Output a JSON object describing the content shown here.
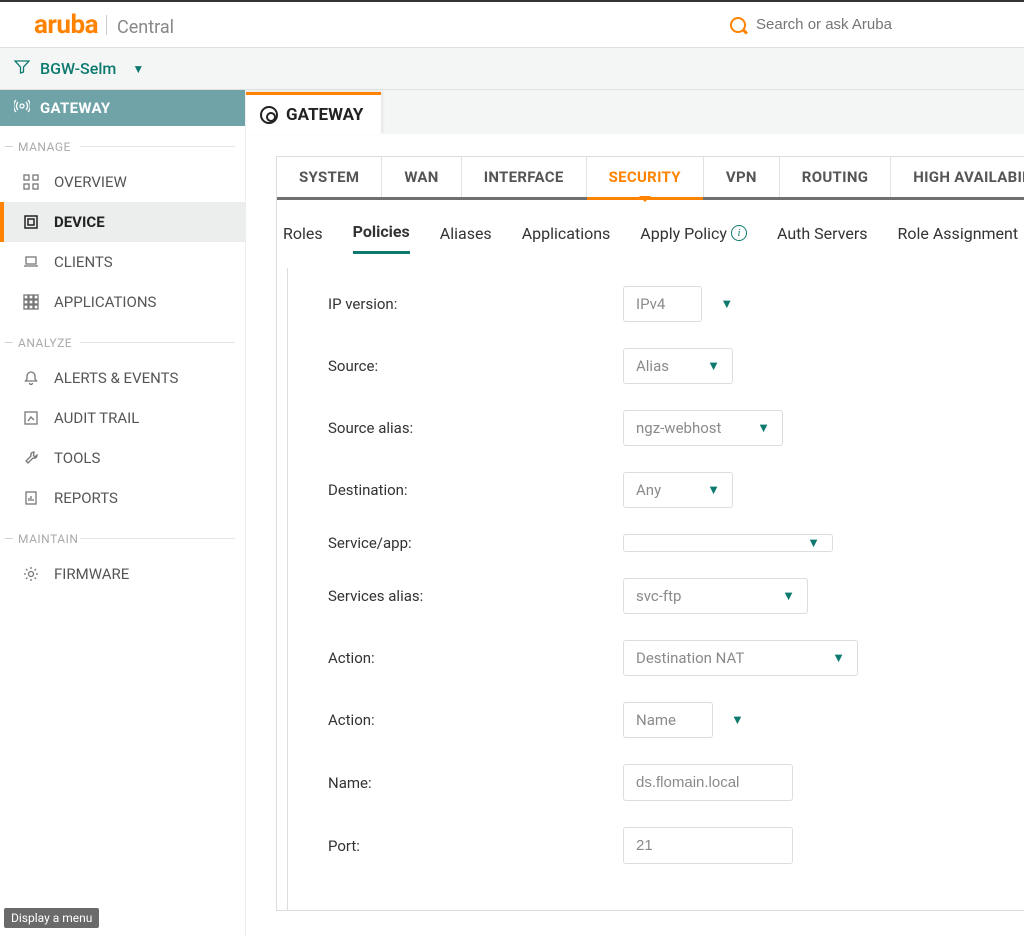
{
  "brand": {
    "name": "aruba",
    "product": "Central"
  },
  "search": {
    "placeholder": "Search or ask Aruba"
  },
  "breadcrumb": {
    "name": "BGW-Selm"
  },
  "sidebar": {
    "header": "GATEWAY",
    "groups": {
      "manage": "MANAGE",
      "analyze": "ANALYZE",
      "maintain": "MAINTAIN"
    },
    "items": {
      "overview": "OVERVIEW",
      "device": "DEVICE",
      "clients": "CLIENTS",
      "applications": "APPLICATIONS",
      "alerts": "ALERTS & EVENTS",
      "audit": "AUDIT TRAIL",
      "tools": "TOOLS",
      "reports": "REPORTS",
      "firmware": "FIRMWARE"
    }
  },
  "mainTab": "GATEWAY",
  "confTabs": {
    "system": "SYSTEM",
    "wan": "WAN",
    "interface": "INTERFACE",
    "security": "SECURITY",
    "vpn": "VPN",
    "routing": "ROUTING",
    "ha": "HIGH AVAILABILITY"
  },
  "subTabs": {
    "roles": "Roles",
    "policies": "Policies",
    "aliases": "Aliases",
    "applications": "Applications",
    "applyPolicy": "Apply Policy",
    "authServers": "Auth Servers",
    "roleAssign": "Role Assignment"
  },
  "form": {
    "ipVersion": {
      "label": "IP version:",
      "value": "IPv4"
    },
    "source": {
      "label": "Source:",
      "value": "Alias"
    },
    "sourceAlias": {
      "label": "Source alias:",
      "value": "ngz-webhost"
    },
    "destination": {
      "label": "Destination:",
      "value": "Any"
    },
    "serviceApp": {
      "label": "Service/app:",
      "value": ""
    },
    "servicesAlias": {
      "label": "Services alias:",
      "value": "svc-ftp"
    },
    "action": {
      "label": "Action:",
      "value": "Destination NAT"
    },
    "action2": {
      "label": "Action:",
      "value": "Name"
    },
    "name": {
      "label": "Name:",
      "value": "ds.flomain.local"
    },
    "port": {
      "label": "Port:",
      "value": "21"
    }
  },
  "footer": {
    "menuTag": "Display a menu"
  }
}
